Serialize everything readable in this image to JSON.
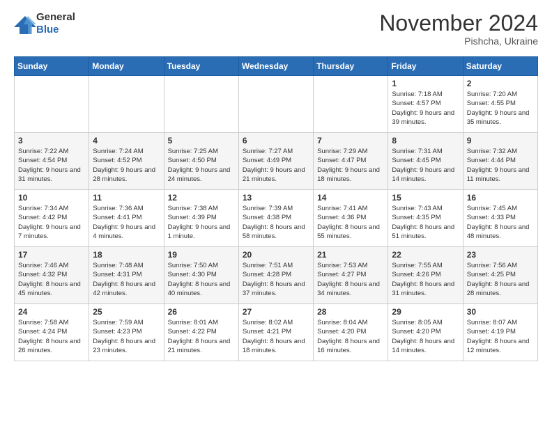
{
  "header": {
    "logo": {
      "text_general": "General",
      "text_blue": "Blue"
    },
    "title": "November 2024",
    "location": "Pishcha, Ukraine"
  },
  "calendar": {
    "weekdays": [
      "Sunday",
      "Monday",
      "Tuesday",
      "Wednesday",
      "Thursday",
      "Friday",
      "Saturday"
    ],
    "weeks": [
      [
        {
          "day": "",
          "info": ""
        },
        {
          "day": "",
          "info": ""
        },
        {
          "day": "",
          "info": ""
        },
        {
          "day": "",
          "info": ""
        },
        {
          "day": "",
          "info": ""
        },
        {
          "day": "1",
          "info": "Sunrise: 7:18 AM\nSunset: 4:57 PM\nDaylight: 9 hours\nand 39 minutes."
        },
        {
          "day": "2",
          "info": "Sunrise: 7:20 AM\nSunset: 4:55 PM\nDaylight: 9 hours\nand 35 minutes."
        }
      ],
      [
        {
          "day": "3",
          "info": "Sunrise: 7:22 AM\nSunset: 4:54 PM\nDaylight: 9 hours\nand 31 minutes."
        },
        {
          "day": "4",
          "info": "Sunrise: 7:24 AM\nSunset: 4:52 PM\nDaylight: 9 hours\nand 28 minutes."
        },
        {
          "day": "5",
          "info": "Sunrise: 7:25 AM\nSunset: 4:50 PM\nDaylight: 9 hours\nand 24 minutes."
        },
        {
          "day": "6",
          "info": "Sunrise: 7:27 AM\nSunset: 4:49 PM\nDaylight: 9 hours\nand 21 minutes."
        },
        {
          "day": "7",
          "info": "Sunrise: 7:29 AM\nSunset: 4:47 PM\nDaylight: 9 hours\nand 18 minutes."
        },
        {
          "day": "8",
          "info": "Sunrise: 7:31 AM\nSunset: 4:45 PM\nDaylight: 9 hours\nand 14 minutes."
        },
        {
          "day": "9",
          "info": "Sunrise: 7:32 AM\nSunset: 4:44 PM\nDaylight: 9 hours\nand 11 minutes."
        }
      ],
      [
        {
          "day": "10",
          "info": "Sunrise: 7:34 AM\nSunset: 4:42 PM\nDaylight: 9 hours\nand 7 minutes."
        },
        {
          "day": "11",
          "info": "Sunrise: 7:36 AM\nSunset: 4:41 PM\nDaylight: 9 hours\nand 4 minutes."
        },
        {
          "day": "12",
          "info": "Sunrise: 7:38 AM\nSunset: 4:39 PM\nDaylight: 9 hours\nand 1 minute."
        },
        {
          "day": "13",
          "info": "Sunrise: 7:39 AM\nSunset: 4:38 PM\nDaylight: 8 hours\nand 58 minutes."
        },
        {
          "day": "14",
          "info": "Sunrise: 7:41 AM\nSunset: 4:36 PM\nDaylight: 8 hours\nand 55 minutes."
        },
        {
          "day": "15",
          "info": "Sunrise: 7:43 AM\nSunset: 4:35 PM\nDaylight: 8 hours\nand 51 minutes."
        },
        {
          "day": "16",
          "info": "Sunrise: 7:45 AM\nSunset: 4:33 PM\nDaylight: 8 hours\nand 48 minutes."
        }
      ],
      [
        {
          "day": "17",
          "info": "Sunrise: 7:46 AM\nSunset: 4:32 PM\nDaylight: 8 hours\nand 45 minutes."
        },
        {
          "day": "18",
          "info": "Sunrise: 7:48 AM\nSunset: 4:31 PM\nDaylight: 8 hours\nand 42 minutes."
        },
        {
          "day": "19",
          "info": "Sunrise: 7:50 AM\nSunset: 4:30 PM\nDaylight: 8 hours\nand 40 minutes."
        },
        {
          "day": "20",
          "info": "Sunrise: 7:51 AM\nSunset: 4:28 PM\nDaylight: 8 hours\nand 37 minutes."
        },
        {
          "day": "21",
          "info": "Sunrise: 7:53 AM\nSunset: 4:27 PM\nDaylight: 8 hours\nand 34 minutes."
        },
        {
          "day": "22",
          "info": "Sunrise: 7:55 AM\nSunset: 4:26 PM\nDaylight: 8 hours\nand 31 minutes."
        },
        {
          "day": "23",
          "info": "Sunrise: 7:56 AM\nSunset: 4:25 PM\nDaylight: 8 hours\nand 28 minutes."
        }
      ],
      [
        {
          "day": "24",
          "info": "Sunrise: 7:58 AM\nSunset: 4:24 PM\nDaylight: 8 hours\nand 26 minutes."
        },
        {
          "day": "25",
          "info": "Sunrise: 7:59 AM\nSunset: 4:23 PM\nDaylight: 8 hours\nand 23 minutes."
        },
        {
          "day": "26",
          "info": "Sunrise: 8:01 AM\nSunset: 4:22 PM\nDaylight: 8 hours\nand 21 minutes."
        },
        {
          "day": "27",
          "info": "Sunrise: 8:02 AM\nSunset: 4:21 PM\nDaylight: 8 hours\nand 18 minutes."
        },
        {
          "day": "28",
          "info": "Sunrise: 8:04 AM\nSunset: 4:20 PM\nDaylight: 8 hours\nand 16 minutes."
        },
        {
          "day": "29",
          "info": "Sunrise: 8:05 AM\nSunset: 4:20 PM\nDaylight: 8 hours\nand 14 minutes."
        },
        {
          "day": "30",
          "info": "Sunrise: 8:07 AM\nSunset: 4:19 PM\nDaylight: 8 hours\nand 12 minutes."
        }
      ]
    ]
  }
}
